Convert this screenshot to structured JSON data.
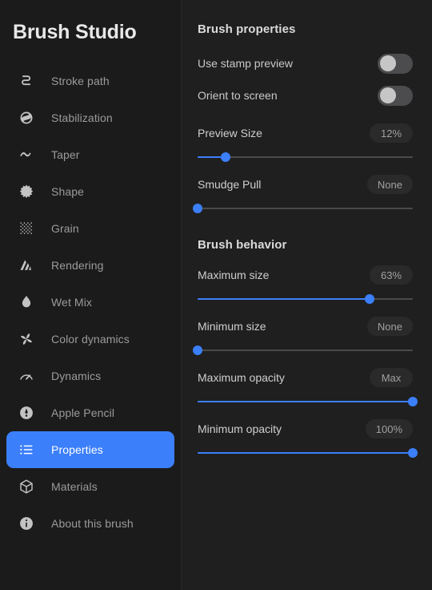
{
  "sidebar": {
    "title": "Brush Studio",
    "items": [
      {
        "label": "Stroke path",
        "icon": "stroke-path-icon",
        "selected": false
      },
      {
        "label": "Stabilization",
        "icon": "stabilization-icon",
        "selected": false
      },
      {
        "label": "Taper",
        "icon": "taper-icon",
        "selected": false
      },
      {
        "label": "Shape",
        "icon": "shape-icon",
        "selected": false
      },
      {
        "label": "Grain",
        "icon": "grain-icon",
        "selected": false
      },
      {
        "label": "Rendering",
        "icon": "rendering-icon",
        "selected": false
      },
      {
        "label": "Wet Mix",
        "icon": "wet-mix-icon",
        "selected": false
      },
      {
        "label": "Color dynamics",
        "icon": "color-dynamics-icon",
        "selected": false
      },
      {
        "label": "Dynamics",
        "icon": "dynamics-icon",
        "selected": false
      },
      {
        "label": "Apple Pencil",
        "icon": "apple-pencil-icon",
        "selected": false
      },
      {
        "label": "Properties",
        "icon": "properties-icon",
        "selected": true
      },
      {
        "label": "Materials",
        "icon": "materials-icon",
        "selected": false
      },
      {
        "label": "About this brush",
        "icon": "info-icon",
        "selected": false
      }
    ]
  },
  "main": {
    "sections": [
      {
        "title": "Brush properties",
        "toggles": [
          {
            "label": "Use stamp preview",
            "on": false
          },
          {
            "label": "Orient to screen",
            "on": false
          }
        ],
        "sliders": [
          {
            "label": "Preview Size",
            "value": "12%",
            "percent": 13
          },
          {
            "label": "Smudge Pull",
            "value": "None",
            "percent": 0
          }
        ]
      },
      {
        "title": "Brush behavior",
        "toggles": [],
        "sliders": [
          {
            "label": "Maximum size",
            "value": "63%",
            "percent": 80
          },
          {
            "label": "Minimum size",
            "value": "None",
            "percent": 0
          },
          {
            "label": "Maximum opacity",
            "value": "Max",
            "percent": 100
          },
          {
            "label": "Minimum opacity",
            "value": "100%",
            "percent": 100
          }
        ]
      }
    ]
  },
  "colors": {
    "accent": "#3b7ffa",
    "sidebar_bg": "#1b1b1b",
    "main_bg": "#1f1f1f",
    "badge_bg": "#2a2a2a",
    "switch_off": "#4c4c4f",
    "switch_knob": "#c6c6c6"
  }
}
